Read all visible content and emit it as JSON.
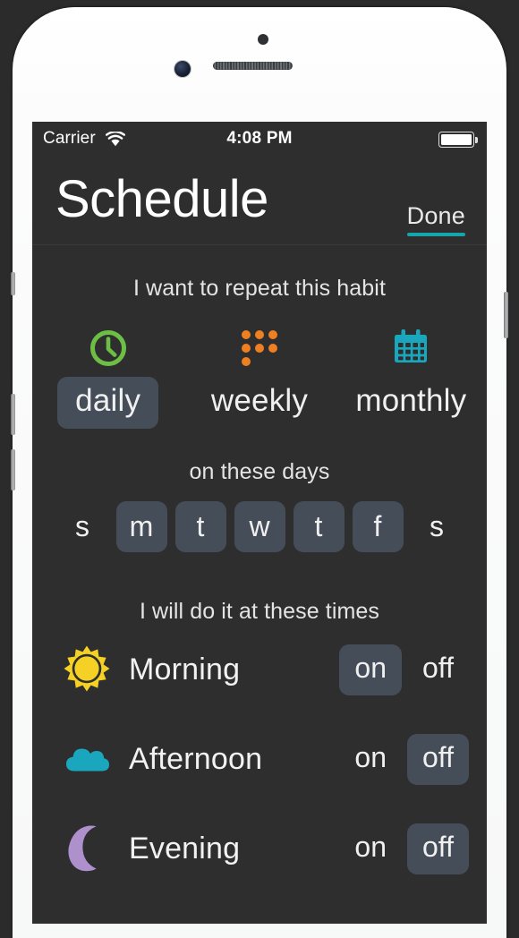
{
  "device": {
    "camera_icon": "front-camera",
    "sensor_icon": "proximity-sensor",
    "speaker_icon": "earpiece-speaker"
  },
  "status_bar": {
    "carrier": "Carrier",
    "wifi_icon": "wifi-icon",
    "time": "4:08 PM",
    "battery_icon": "battery-full-icon"
  },
  "nav_bar": {
    "title": "Schedule",
    "done_label": "Done",
    "accent_color": "#14a5ad"
  },
  "repeat_section": {
    "caption": "I want to repeat this habit",
    "selected": "daily",
    "options": [
      {
        "label": "daily",
        "icon": "clock-icon",
        "icon_color": "#6cbe45",
        "selected": true
      },
      {
        "label": "weekly",
        "icon": "dots-grid-icon",
        "icon_color": "#ef8022",
        "selected": false
      },
      {
        "label": "monthly",
        "icon": "calendar-icon",
        "icon_color": "#1aa7bd",
        "selected": false
      }
    ]
  },
  "days_section": {
    "caption": "on these days",
    "days": [
      {
        "label": "s",
        "selected": false
      },
      {
        "label": "m",
        "selected": true
      },
      {
        "label": "t",
        "selected": true
      },
      {
        "label": "w",
        "selected": true
      },
      {
        "label": "t",
        "selected": true
      },
      {
        "label": "f",
        "selected": true
      },
      {
        "label": "s",
        "selected": false
      }
    ]
  },
  "times_section": {
    "caption": "I will do it at these times",
    "on_label": "on",
    "off_label": "off",
    "rows": [
      {
        "label": "Morning",
        "icon": "sun-icon",
        "icon_color": "#f5d125",
        "state": "on"
      },
      {
        "label": "Afternoon",
        "icon": "cloud-icon",
        "icon_color": "#1aa7bd",
        "state": "off"
      },
      {
        "label": "Evening",
        "icon": "moon-icon",
        "icon_color": "#ae90cc",
        "state": "off"
      }
    ]
  },
  "theme": {
    "screen_background": "#2e2e2e",
    "selected_pill": "#454d59",
    "text_primary": "#f0f0f0"
  }
}
